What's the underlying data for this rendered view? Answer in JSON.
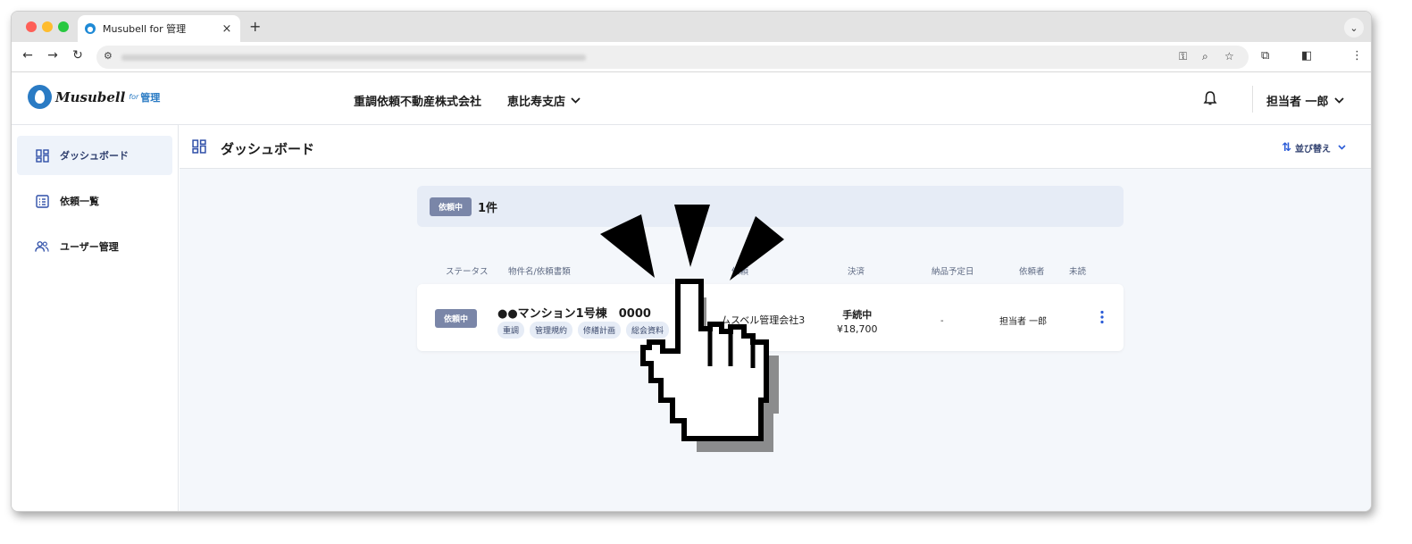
{
  "browser": {
    "tab_title": "Musubell for 管理",
    "tab_close": "×",
    "new_tab": "+"
  },
  "header": {
    "logo_text": "Musubell",
    "logo_for": "for",
    "logo_kanri": "管理",
    "company": "重調依頼不動産株式会社",
    "branch": "恵比寿支店",
    "user": "担当者 一郎"
  },
  "sidebar": {
    "items": [
      {
        "label": "ダッシュボード",
        "icon": "dashboard-icon"
      },
      {
        "label": "依頼一覧",
        "icon": "list-icon"
      },
      {
        "label": "ユーザー管理",
        "icon": "users-icon"
      }
    ]
  },
  "main": {
    "title": "ダッシュボード",
    "sort_label": "並び替え",
    "summary": {
      "badge": "依頼中",
      "count": "1件"
    },
    "columns": [
      "ステータス",
      "物件名/依頼書類",
      "依頼",
      "決済",
      "納品予定日",
      "依頼者",
      "未読"
    ],
    "rows": [
      {
        "status": "依頼中",
        "property": "●●マンション1号棟　0000",
        "tags": [
          "重調",
          "管理規約",
          "修繕計画",
          "総会資料"
        ],
        "client": "ムスベル管理会社3",
        "settlement_status": "手続中",
        "settlement_amount": "¥18,700",
        "delivery_date": "-",
        "requester": "担当者 一郎"
      }
    ]
  },
  "colors": {
    "accent": "#2a5bd7",
    "badge": "#7a86a8",
    "sidebar_active": "#eef3fa",
    "main_bg": "#f4f7fb"
  }
}
